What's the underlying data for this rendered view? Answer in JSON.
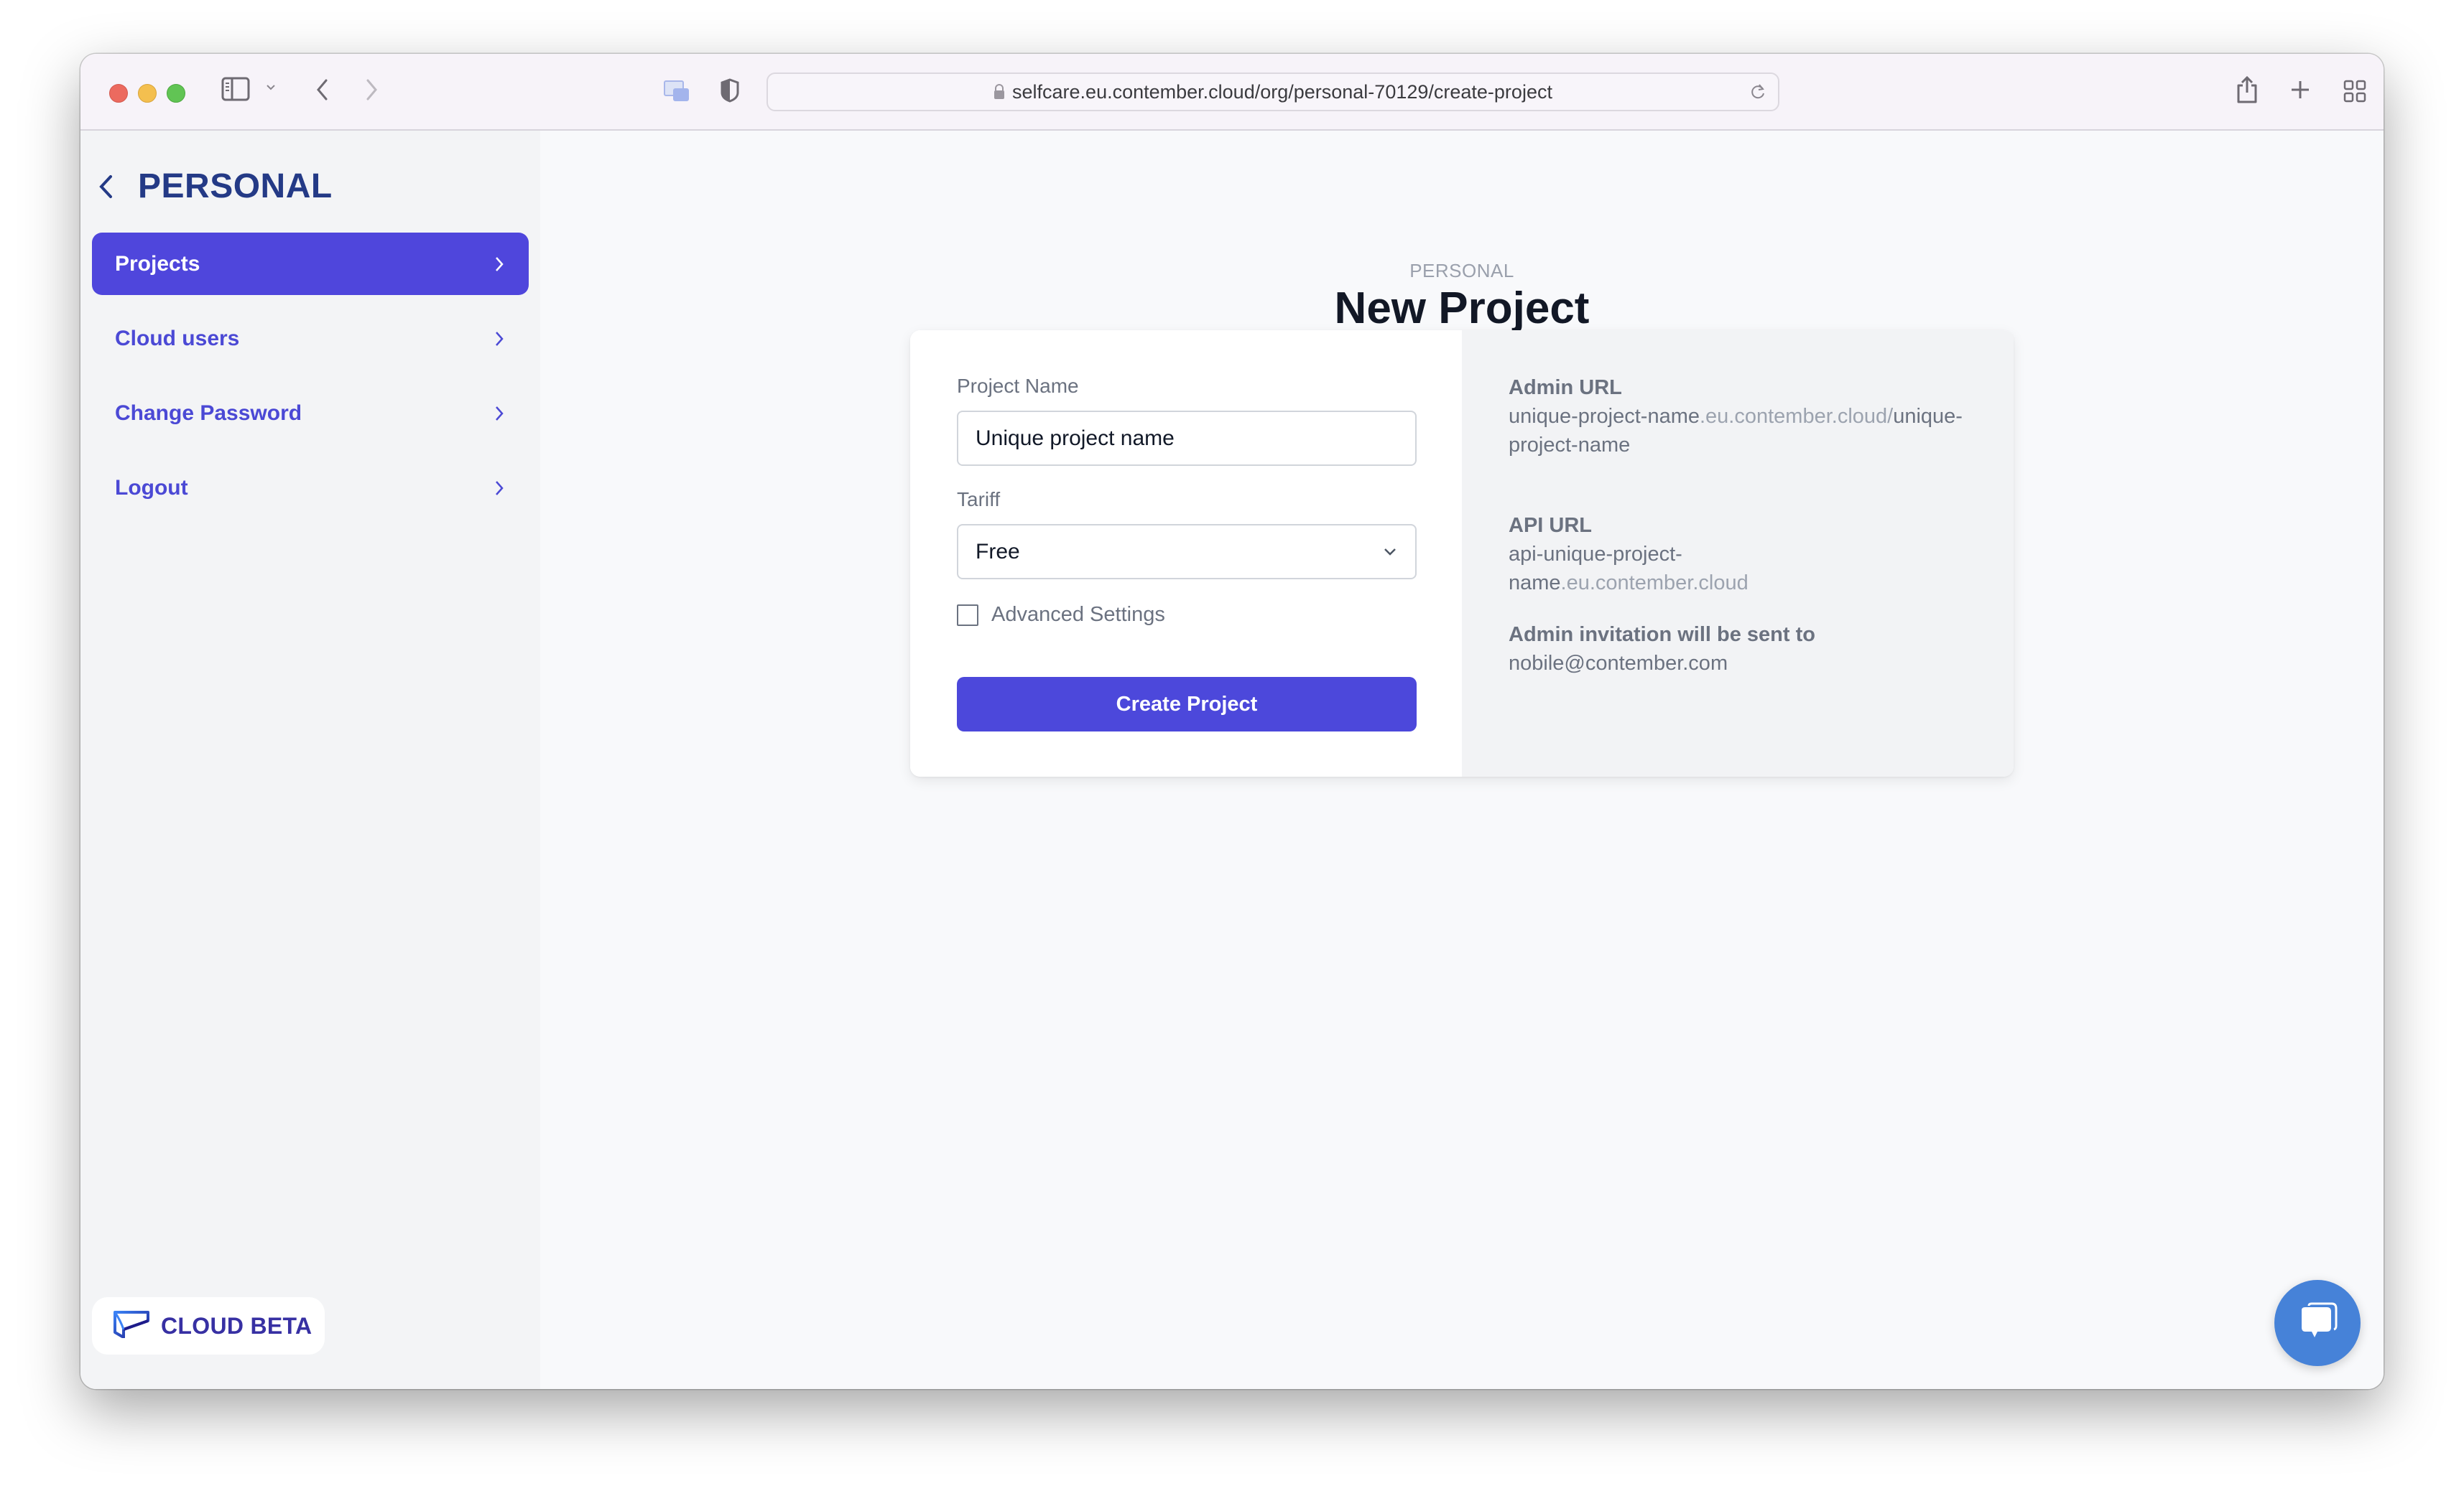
{
  "browser": {
    "url": "selfcare.eu.contember.cloud/org/personal-70129/create-project",
    "icons": {
      "sidebar_toggle": "sidebar-icon",
      "back": "chevron-left-icon",
      "forward": "chevron-right-icon",
      "tab_overview": "picture-in-picture-icon",
      "privacy": "shield-icon",
      "lock": "lock-icon",
      "reload": "reload-icon",
      "share": "share-icon",
      "new_tab": "plus-icon",
      "tabs_grid": "grid-icon"
    }
  },
  "sidebar": {
    "org_title": "PERSONAL",
    "items": [
      {
        "label": "Projects",
        "active": true
      },
      {
        "label": "Cloud users",
        "active": false
      },
      {
        "label": "Change Password",
        "active": false
      },
      {
        "label": "Logout",
        "active": false
      }
    ],
    "brand_label": "CLOUD BETA"
  },
  "main": {
    "subtitle": "PERSONAL",
    "title": "New Project",
    "form": {
      "project_name_label": "Project Name",
      "project_name_value": "Unique project name",
      "tariff_label": "Tariff",
      "tariff_value": "Free",
      "advanced_settings_label": "Advanced Settings",
      "advanced_settings_checked": false,
      "submit_label": "Create Project"
    },
    "info": {
      "admin_url_label": "Admin URL",
      "admin_url_part1": "unique-project-name",
      "admin_url_domain": ".eu.contember.cloud/",
      "admin_url_part2": "unique-project-name",
      "api_url_label": "API URL",
      "api_url_part1": "api-unique-project-name",
      "api_url_domain": ".eu.contember.cloud",
      "invitation_label": "Admin invitation will be sent to",
      "invitation_email": "nobile@contember.com"
    }
  },
  "colors": {
    "accent": "#4f46dc",
    "brand_dark": "#243a86",
    "chat_button": "#4682d8"
  }
}
